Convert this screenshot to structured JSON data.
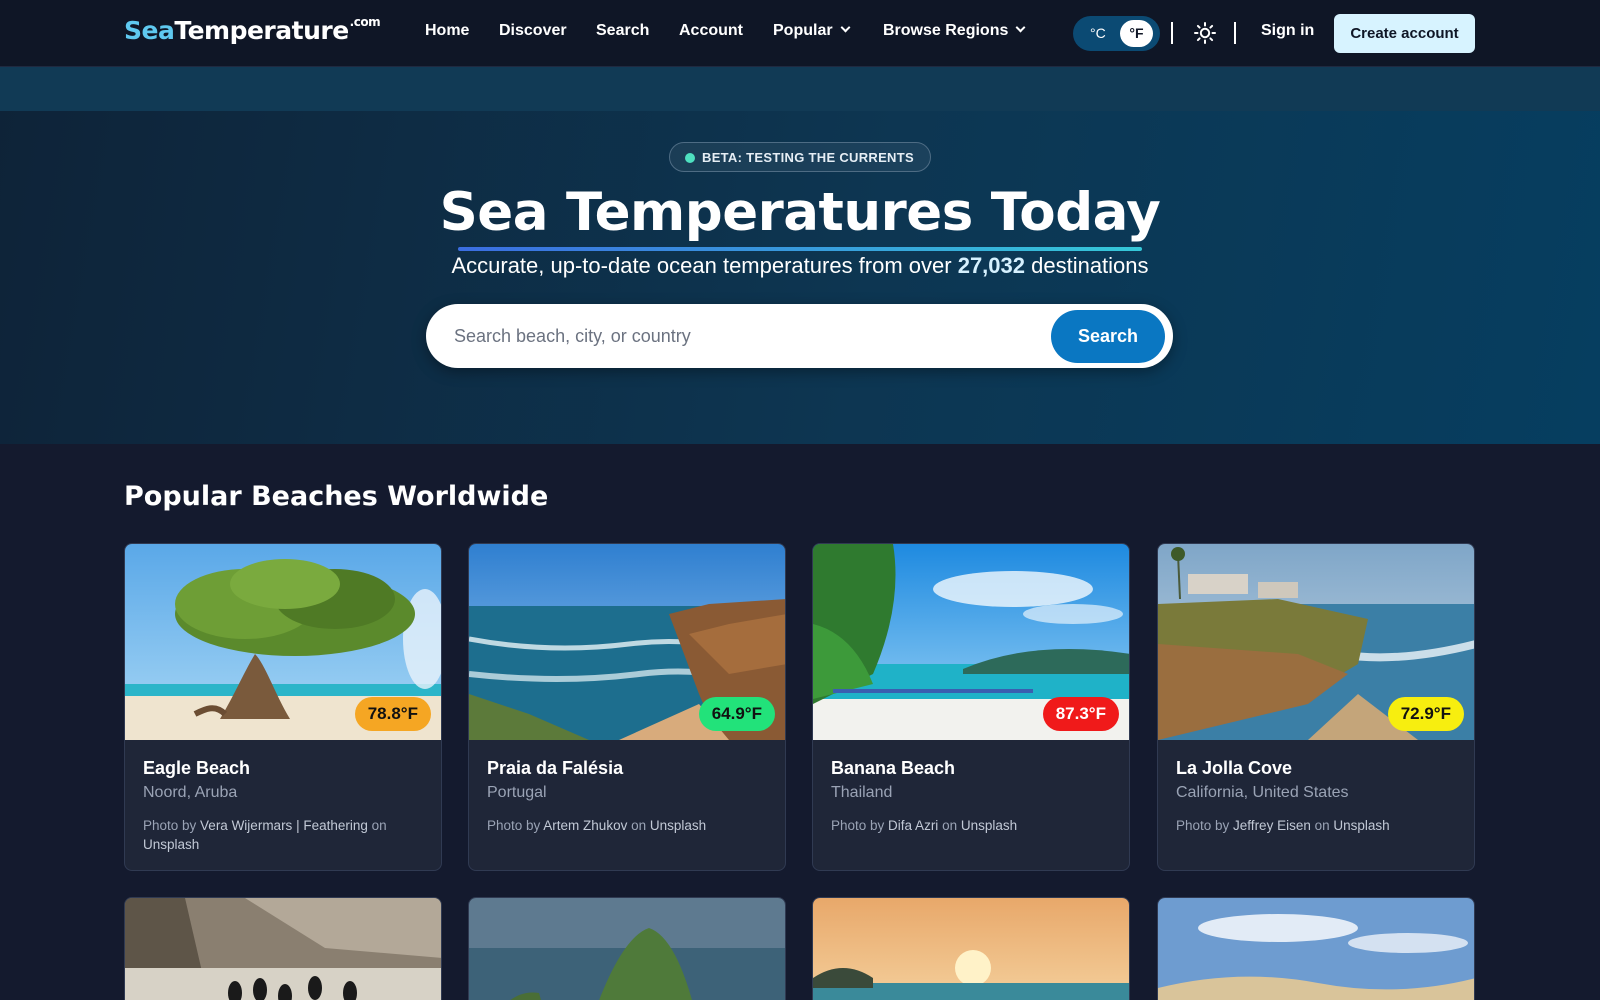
{
  "nav": {
    "logo_sea": "Sea",
    "logo_temp": "Temperature",
    "logo_tld": ".com",
    "links": [
      "Home",
      "Discover",
      "Search",
      "Account",
      "Popular",
      "Browse Regions"
    ],
    "unit_c": "°C",
    "unit_f": "°F",
    "unit_selected": "°F",
    "sign_in": "Sign in",
    "create_account": "Create account"
  },
  "hero": {
    "badge": "BETA: TESTING THE CURRENTS",
    "title": "Sea Temperatures Today",
    "subtitle_pre": "Accurate, up-to-date ocean temperatures from over ",
    "subtitle_count": "27,032",
    "subtitle_post": " destinations",
    "search_placeholder": "Search beach, city, or country",
    "search_button": "Search"
  },
  "popular": {
    "title": "Popular Beaches Worldwide",
    "cards": [
      {
        "name": "Eagle Beach",
        "location": "Noord, Aruba",
        "temp": "78.8°F",
        "badge_color": "#f5a623",
        "credit_pre": "Photo by ",
        "photographer": "Vera Wijermars | Feathering",
        "credit_mid": " on ",
        "source": "Unsplash"
      },
      {
        "name": "Praia da Falésia",
        "location": "Portugal",
        "temp": "64.9°F",
        "badge_color": "#22e27a",
        "credit_pre": "Photo by ",
        "photographer": "Artem Zhukov",
        "credit_mid": " on ",
        "source": "Unsplash"
      },
      {
        "name": "Banana Beach",
        "location": "Thailand",
        "temp": "87.3°F",
        "badge_color": "#f01a1a",
        "credit_pre": "Photo by ",
        "photographer": "Difa Azri",
        "credit_mid": " on ",
        "source": "Unsplash"
      },
      {
        "name": "La Jolla Cove",
        "location": "California, United States",
        "temp": "72.9°F",
        "badge_color": "#f7ee0f",
        "credit_pre": "Photo by ",
        "photographer": "Jeffrey Eisen",
        "credit_mid": " on ",
        "source": "Unsplash"
      }
    ]
  }
}
